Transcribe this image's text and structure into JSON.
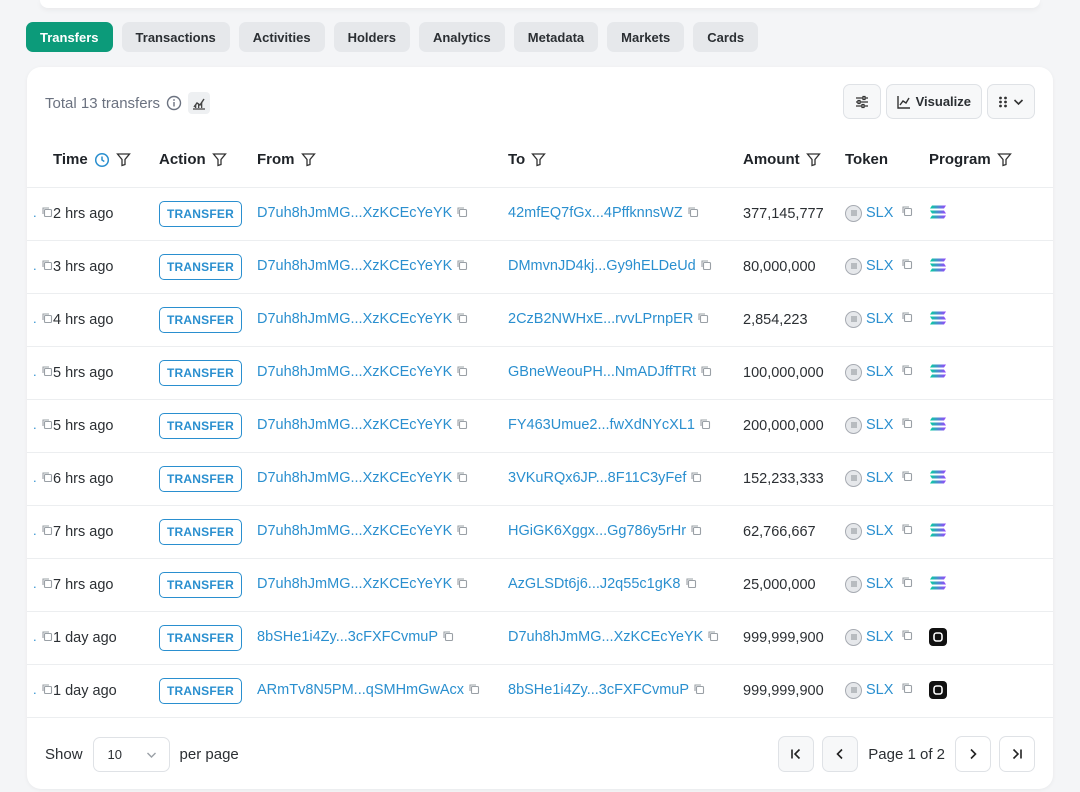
{
  "tabs": [
    {
      "label": "Transfers",
      "active": true
    },
    {
      "label": "Transactions",
      "active": false
    },
    {
      "label": "Activities",
      "active": false
    },
    {
      "label": "Holders",
      "active": false
    },
    {
      "label": "Analytics",
      "active": false
    },
    {
      "label": "Metadata",
      "active": false
    },
    {
      "label": "Markets",
      "active": false
    },
    {
      "label": "Cards",
      "active": false
    }
  ],
  "header": {
    "total_label": "Total 13 transfers",
    "visualize_label": "Visualize"
  },
  "columns": {
    "time": "Time",
    "action": "Action",
    "from": "From",
    "to": "To",
    "amount": "Amount",
    "token": "Token",
    "program": "Program"
  },
  "rows": [
    {
      "time": "2 hrs ago",
      "action": "TRANSFER",
      "from": "D7uh8hJmMG...XzKCEcYeYK",
      "to": "42mfEQ7fGx...4PffknnsWZ",
      "amount": "377,145,777",
      "token": "SLX",
      "program_icon": "solana-gradient-icon"
    },
    {
      "time": "3 hrs ago",
      "action": "TRANSFER",
      "from": "D7uh8hJmMG...XzKCEcYeYK",
      "to": "DMmvnJD4kj...Gy9hELDeUd",
      "amount": "80,000,000",
      "token": "SLX",
      "program_icon": "solana-gradient-icon"
    },
    {
      "time": "4 hrs ago",
      "action": "TRANSFER",
      "from": "D7uh8hJmMG...XzKCEcYeYK",
      "to": "2CzB2NWHxE...rvvLPrnpER",
      "amount": "2,854,223",
      "token": "SLX",
      "program_icon": "solana-gradient-icon"
    },
    {
      "time": "5 hrs ago",
      "action": "TRANSFER",
      "from": "D7uh8hJmMG...XzKCEcYeYK",
      "to": "GBneWeouPH...NmADJffTRt",
      "amount": "100,000,000",
      "token": "SLX",
      "program_icon": "solana-gradient-icon"
    },
    {
      "time": "5 hrs ago",
      "action": "TRANSFER",
      "from": "D7uh8hJmMG...XzKCEcYeYK",
      "to": "FY463Umue2...fwXdNYcXL1",
      "amount": "200,000,000",
      "token": "SLX",
      "program_icon": "solana-gradient-icon"
    },
    {
      "time": "6 hrs ago",
      "action": "TRANSFER",
      "from": "D7uh8hJmMG...XzKCEcYeYK",
      "to": "3VKuRQx6JP...8F11C3yFef",
      "amount": "152,233,333",
      "token": "SLX",
      "program_icon": "solana-gradient-icon"
    },
    {
      "time": "7 hrs ago",
      "action": "TRANSFER",
      "from": "D7uh8hJmMG...XzKCEcYeYK",
      "to": "HGiGK6Xggx...Gg786y5rHr",
      "amount": "62,766,667",
      "token": "SLX",
      "program_icon": "solana-gradient-icon"
    },
    {
      "time": "7 hrs ago",
      "action": "TRANSFER",
      "from": "D7uh8hJmMG...XzKCEcYeYK",
      "to": "AzGLSDt6j6...J2q55c1gK8",
      "amount": "25,000,000",
      "token": "SLX",
      "program_icon": "solana-gradient-icon"
    },
    {
      "time": "1 day ago",
      "action": "TRANSFER",
      "from": "8bSHe1i4Zy...3cFXFCvmuP",
      "to": "D7uh8hJmMG...XzKCEcYeYK",
      "amount": "999,999,900",
      "token": "SLX",
      "program_icon": "dark-square-program-icon"
    },
    {
      "time": "1 day ago",
      "action": "TRANSFER",
      "from": "ARmTv8N5PM...qSMHmGwAcx",
      "to": "8bSHe1i4Zy...3cFXFCvmuP",
      "amount": "999,999,900",
      "token": "SLX",
      "program_icon": "dark-square-program-icon"
    }
  ],
  "footer": {
    "show_label": "Show",
    "per_page_value": "10",
    "per_page_label": "per page",
    "page_label": "Page 1 of 2"
  },
  "colors": {
    "accent": "#0c9b7a",
    "link": "#2a8fcf"
  }
}
